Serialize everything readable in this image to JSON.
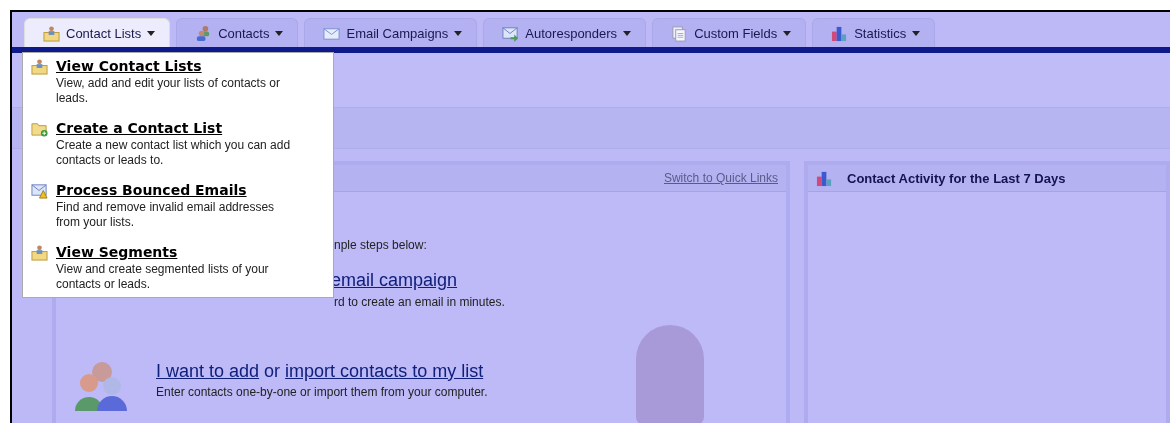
{
  "tabs": [
    {
      "label": "Contact Lists",
      "selected": true
    },
    {
      "label": "Contacts",
      "selected": false
    },
    {
      "label": "Email Campaigns",
      "selected": false
    },
    {
      "label": "Autoresponders",
      "selected": false
    },
    {
      "label": "Custom Fields",
      "selected": false
    },
    {
      "label": "Statistics",
      "selected": false
    }
  ],
  "dropdown": {
    "items": [
      {
        "title": "View Contact Lists",
        "description": "View, add and edit your lists of contacts or leads."
      },
      {
        "title": "Create a Contact List",
        "description": "Create a new contact list which you can add contacts or leads to."
      },
      {
        "title": "Process Bounced Emails",
        "description": "Find and remove invalid email addresses from your lists."
      },
      {
        "title": "View Segments",
        "description": "View and create segmented lists of your contacts or leads."
      }
    ]
  },
  "left_panel": {
    "link": "Switch to Quick Links",
    "intro": "nple steps below:",
    "step_1": {
      "title": "email campaign",
      "description": "rd to create an email in minutes."
    },
    "step_2": {
      "links": [
        "I want to add",
        "import contacts to my list"
      ],
      "joiner": "or",
      "description": "Enter contacts one-by-one or import them from your computer."
    }
  },
  "right_panel": {
    "title": "Contact Activity for the Last 7 Days"
  }
}
